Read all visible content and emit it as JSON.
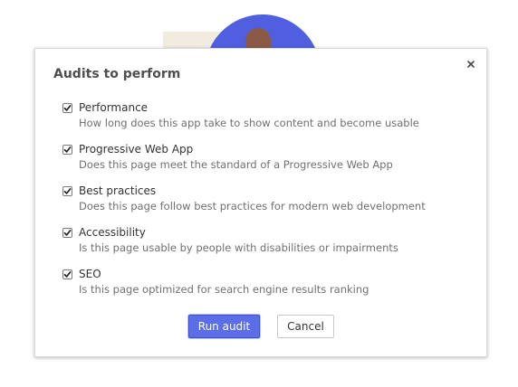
{
  "dialog": {
    "title": "Audits to perform",
    "close_icon": "close-icon"
  },
  "audits": [
    {
      "name": "Performance",
      "description": "How long does this app take to show content and become usable",
      "checked": true
    },
    {
      "name": "Progressive Web App",
      "description": "Does this page meet the standard of a Progressive Web App",
      "checked": true
    },
    {
      "name": "Best practices",
      "description": "Does this page follow best practices for modern web development",
      "checked": true
    },
    {
      "name": "Accessibility",
      "description": "Is this page usable by people with disabilities or impairments",
      "checked": true
    },
    {
      "name": "SEO",
      "description": "Is this page optimized for search engine results ranking",
      "checked": true
    }
  ],
  "actions": {
    "run_label": "Run audit",
    "cancel_label": "Cancel"
  },
  "colors": {
    "accent": "#5b6ee8",
    "illustration_blue": "#4f5fe0",
    "illustration_beige": "#f0ece0",
    "illustration_brown": "#8a5a44"
  }
}
